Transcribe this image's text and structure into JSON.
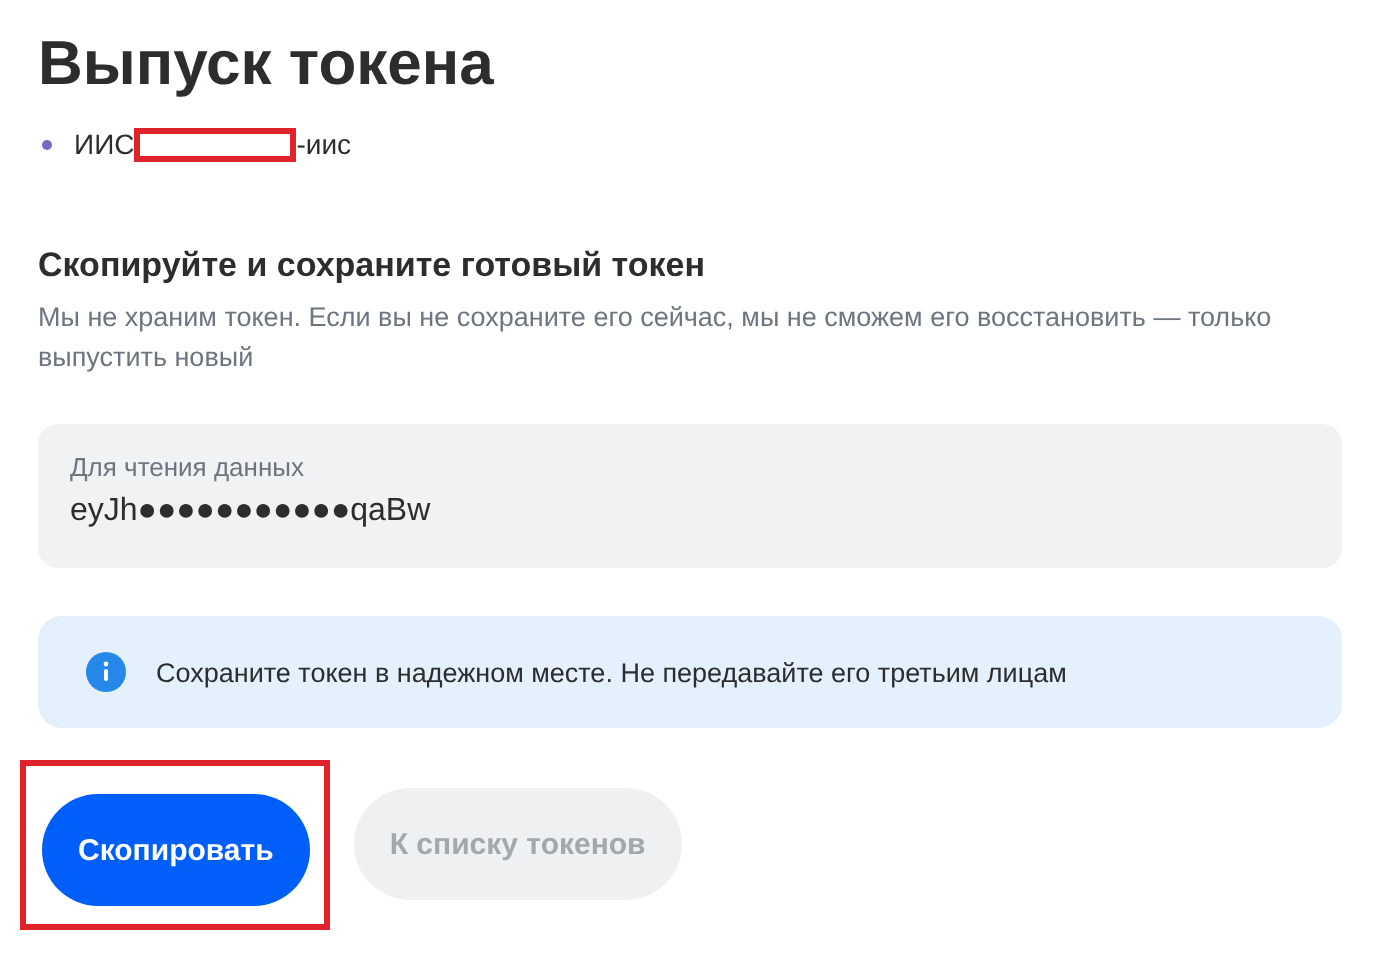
{
  "title": "Выпуск токена",
  "account": {
    "prefix": "ИИС",
    "suffix": "-иис",
    "redacted": true
  },
  "section": {
    "heading": "Скопируйте и сохраните готовый токен",
    "description": "Мы не храним токен. Если вы не сохраните его сейчас, мы не сможем его восстановить — только выпустить новый"
  },
  "token_field": {
    "label": "Для чтения данных",
    "value": "eyJh●●●●●●●●●●●qaBw"
  },
  "notice": {
    "text": "Сохраните токен в надежном месте. Не передавайте его третьим лицам"
  },
  "buttons": [
    {
      "label": "Скопировать",
      "kind": "primary",
      "disabled": false,
      "highlighted": true
    },
    {
      "label": "К списку токенов",
      "kind": "secondary",
      "disabled": true,
      "highlighted": false
    }
  ]
}
